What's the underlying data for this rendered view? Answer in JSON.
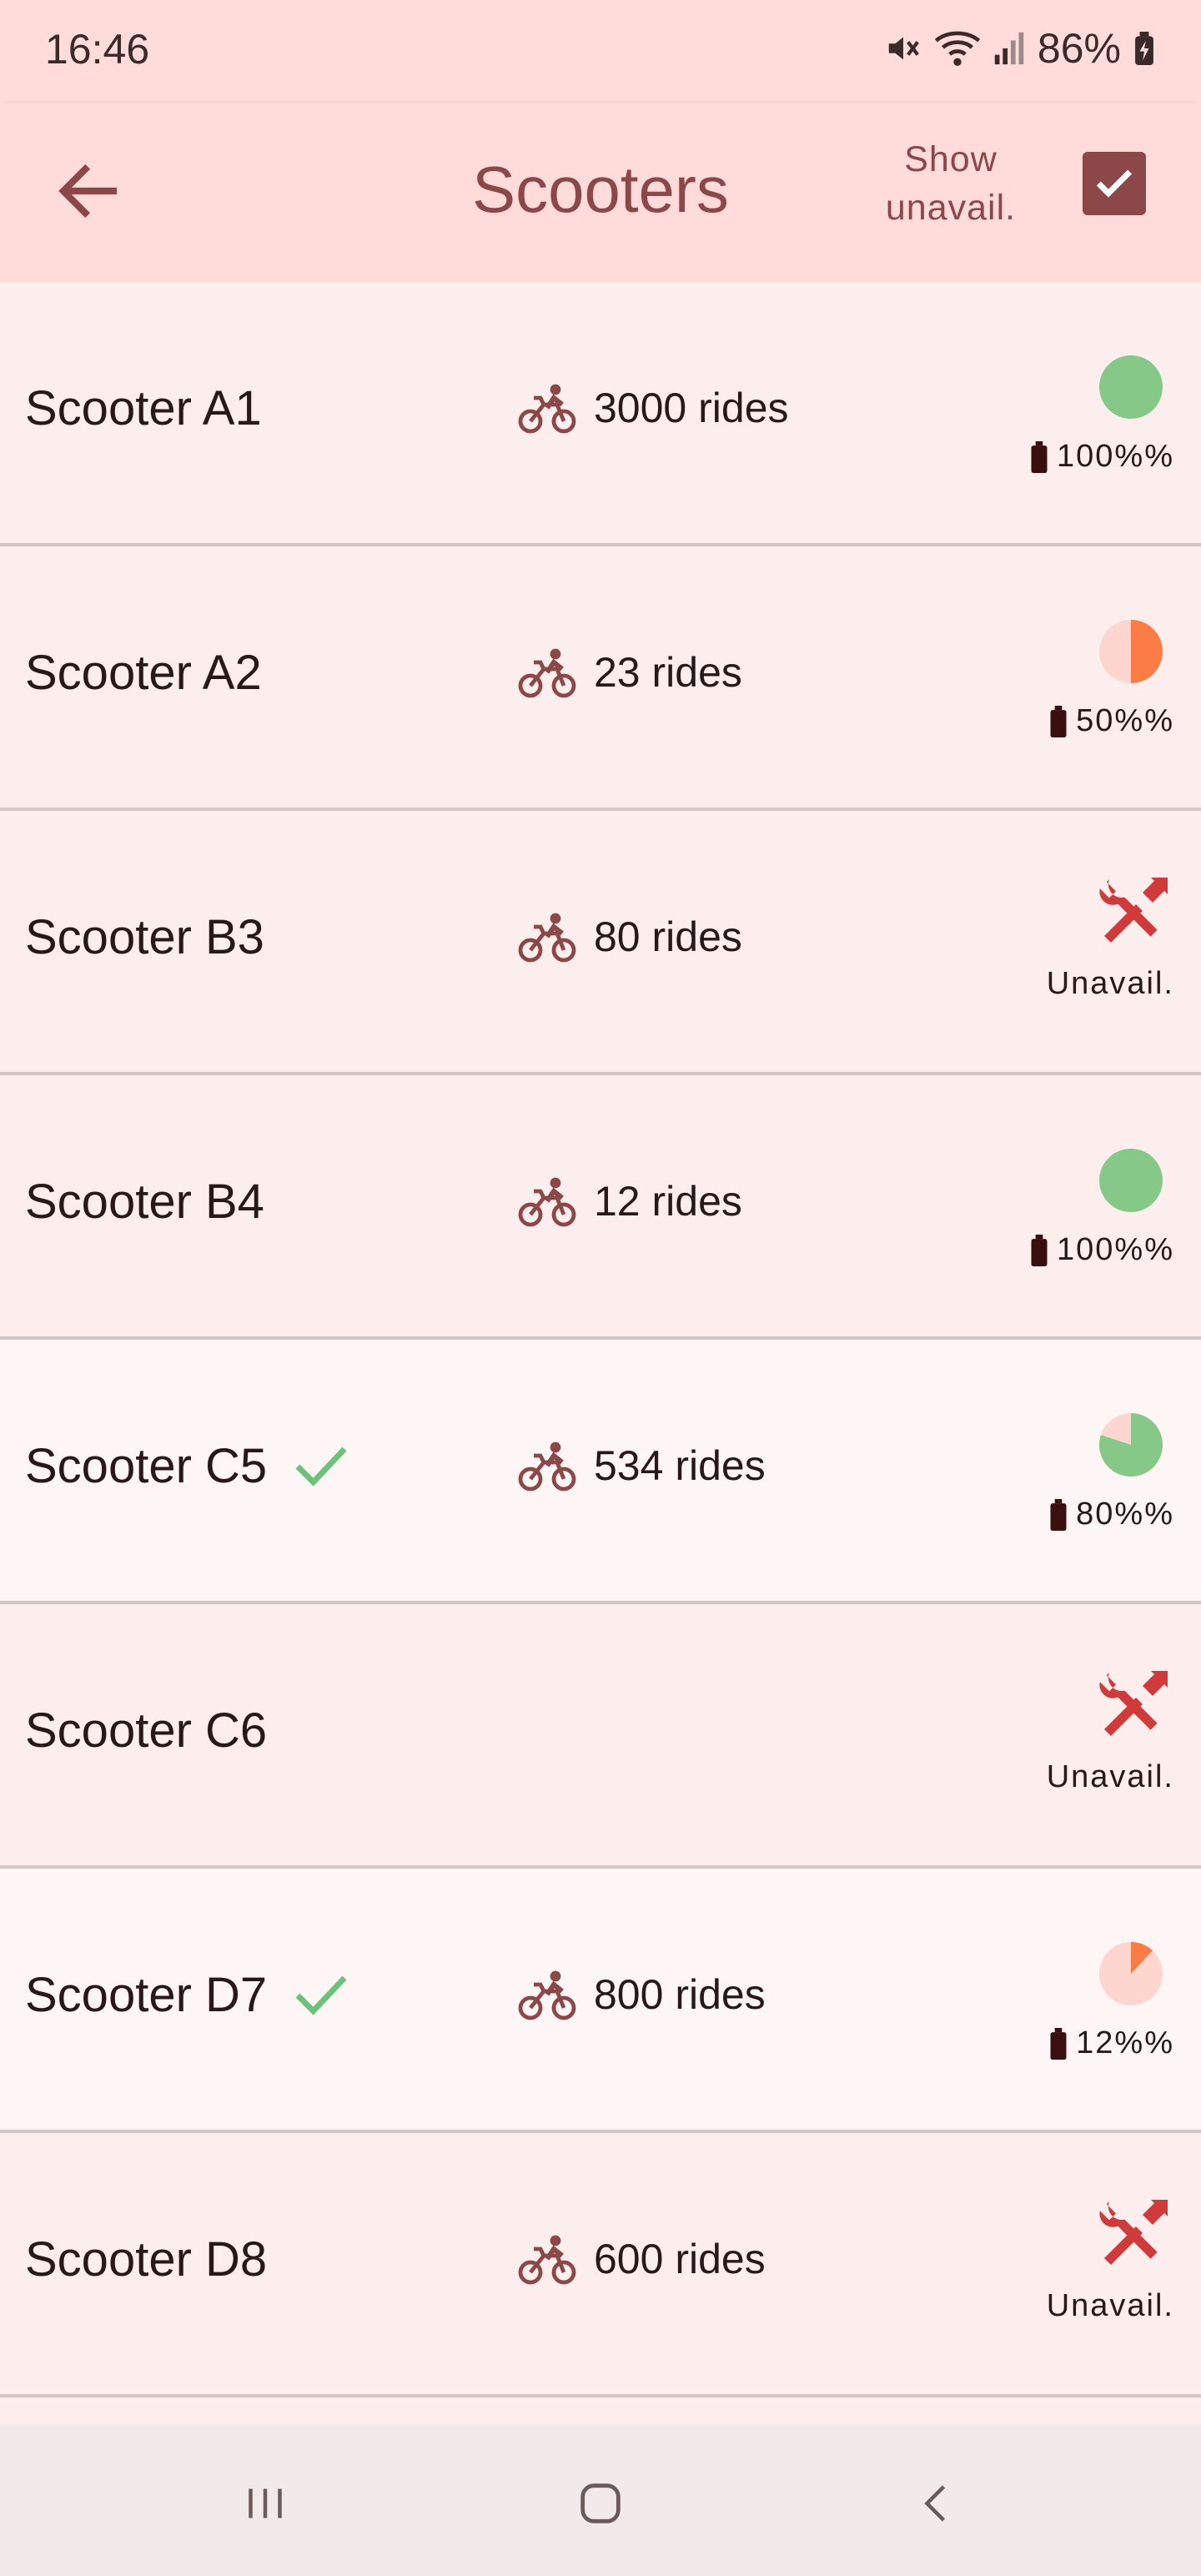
{
  "status_bar": {
    "time": "16:46",
    "battery_percent": "86%",
    "icons": [
      "mute-icon",
      "wifi-icon",
      "signal-icon",
      "battery-charging-icon"
    ]
  },
  "app_bar": {
    "title": "Scooters",
    "show_unavailable_label_line1": "Show",
    "show_unavailable_label_line2": "unavail.",
    "show_unavailable_checked": true,
    "back_icon": "arrow-back-icon"
  },
  "colors": {
    "accent": "#8c4848",
    "battery_full": "#86c887",
    "battery_mid": "#fb7c45",
    "pie_background": "#fdd6d0",
    "unavailable": "#d03a3a",
    "check_green": "#6cc27a"
  },
  "scooters": [
    {
      "name": "Scooter A1",
      "rides": "3000 rides",
      "selected": false,
      "available": true,
      "battery_fraction": 1.0,
      "battery_text": "100%%"
    },
    {
      "name": "Scooter A2",
      "rides": "23 rides",
      "selected": false,
      "available": true,
      "battery_fraction": 0.5,
      "battery_text": "50%%"
    },
    {
      "name": "Scooter B3",
      "rides": "80 rides",
      "selected": false,
      "available": false,
      "unavail_text": "Unavail."
    },
    {
      "name": "Scooter B4",
      "rides": "12 rides",
      "selected": false,
      "available": true,
      "battery_fraction": 1.0,
      "battery_text": "100%%"
    },
    {
      "name": "Scooter C5",
      "rides": "534 rides",
      "selected": true,
      "available": true,
      "battery_fraction": 0.8,
      "battery_text": "80%%"
    },
    {
      "name": "Scooter C6",
      "rides": "",
      "selected": false,
      "available": false,
      "unavail_text": "Unavail."
    },
    {
      "name": "Scooter D7",
      "rides": "800 rides",
      "selected": true,
      "available": true,
      "battery_fraction": 0.12,
      "battery_text": "12%%"
    },
    {
      "name": "Scooter D8",
      "rides": "600 rides",
      "selected": false,
      "available": false,
      "unavail_text": "Unavail."
    }
  ],
  "nav_bar": {
    "icons": [
      "recent-apps-icon",
      "home-icon",
      "nav-back-icon"
    ]
  }
}
